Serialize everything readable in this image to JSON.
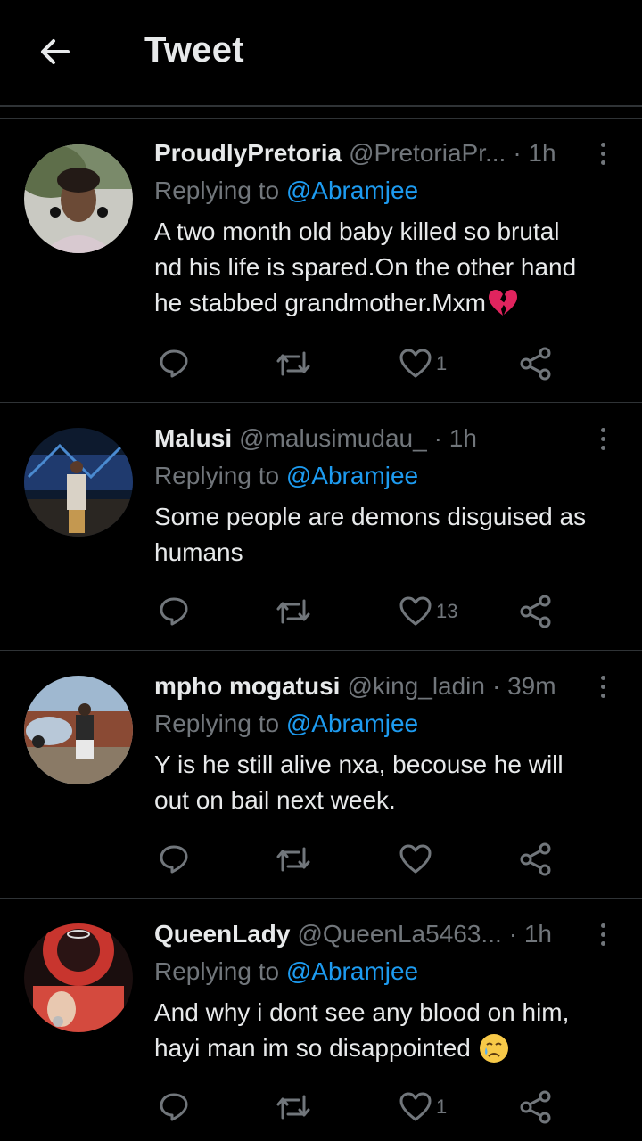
{
  "header": {
    "title": "Tweet"
  },
  "replies": [
    {
      "display_name": "ProudlyPretoria",
      "handle": "@PretoriaPr...",
      "time": "· 1h",
      "replying_prefix": "Replying to",
      "replying_to": "@Abramjee",
      "lines": [
        "A two month old baby killed so brutal",
        "nd his life is spared.On the other hand",
        "he stabbed grandmother.Mxm"
      ],
      "emoji": "broken-heart-icon",
      "like_count": "1",
      "accent": "#1d9bf0"
    },
    {
      "display_name": "Malusi",
      "handle": "@malusimudau_",
      "time": "· 1h",
      "replying_prefix": "Replying to",
      "replying_to": "@Abramjee",
      "lines": [
        "Some people are demons disguised as",
        "humans"
      ],
      "like_count": "13"
    },
    {
      "display_name": "mpho mogatusi",
      "handle": "@king_ladin",
      "time": "· 39m",
      "replying_prefix": "Replying to",
      "replying_to": "@Abramjee",
      "lines": [
        "Y is he still alive nxa, becouse he will",
        "out on bail next week."
      ],
      "like_count": ""
    },
    {
      "display_name": "QueenLady",
      "handle": "@QueenLa5463...",
      "time": "· 1h",
      "replying_prefix": "Replying to",
      "replying_to": "@Abramjee",
      "lines": [
        "And why i dont see any blood on him,",
        "hayi man im so disappointed"
      ],
      "emoji": "crying-face-icon",
      "like_count": "1"
    }
  ],
  "colors": {
    "background": "#000000",
    "text": "#e7e9ea",
    "muted": "#71767b",
    "link": "#1d9bf0",
    "divider": "#2f3336"
  }
}
